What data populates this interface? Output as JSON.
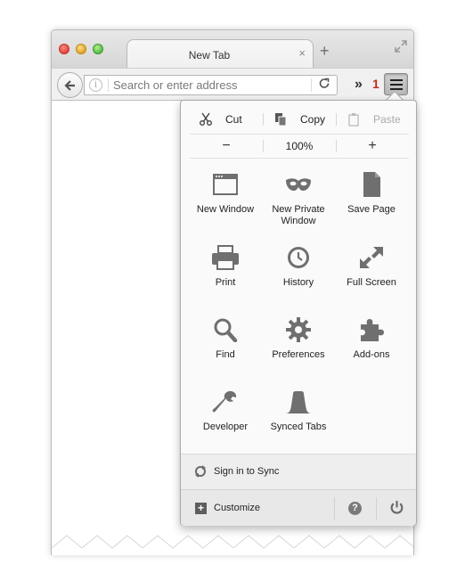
{
  "browser": {
    "tab_title": "New Tab",
    "tab_close": "×",
    "new_tab": "+",
    "url_placeholder": "Search or enter address",
    "overflow": "»",
    "badge": "1"
  },
  "panel": {
    "edit": {
      "cut": "Cut",
      "copy": "Copy",
      "paste": "Paste"
    },
    "zoom": {
      "minus": "−",
      "value": "100%",
      "plus": "+"
    },
    "items": [
      {
        "label": "New Window",
        "icon": "window-icon"
      },
      {
        "label": "New Private Window",
        "icon": "mask-icon"
      },
      {
        "label": "Save Page",
        "icon": "page-icon"
      },
      {
        "label": "Print",
        "icon": "printer-icon"
      },
      {
        "label": "History",
        "icon": "clock-icon"
      },
      {
        "label": "Full Screen",
        "icon": "fullscreen-icon"
      },
      {
        "label": "Find",
        "icon": "magnifier-icon"
      },
      {
        "label": "Preferences",
        "icon": "gear-icon"
      },
      {
        "label": "Add-ons",
        "icon": "puzzle-icon"
      },
      {
        "label": "Developer",
        "icon": "wrench-icon"
      },
      {
        "label": "Synced Tabs",
        "icon": "synced-tabs-icon"
      }
    ],
    "sync_label": "Sign in to Sync",
    "customize_label": "Customize"
  },
  "colors": {
    "badge": "#c32a1c",
    "icon": "#6f6f6f"
  }
}
